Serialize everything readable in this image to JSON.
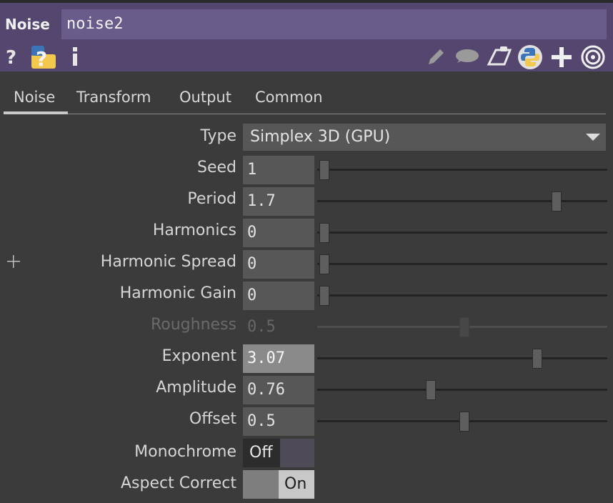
{
  "header": {
    "op_type": "Noise",
    "op_name": "noise2",
    "left_icons": [
      "help-icon",
      "operator-help-icon",
      "info-icon"
    ],
    "right_icons": [
      "pencil-icon",
      "comment-icon",
      "clipboard-icon",
      "python-icon",
      "plus-icon",
      "target-icon"
    ]
  },
  "tabs": [
    {
      "label": "Noise",
      "active": true
    },
    {
      "label": "Transform",
      "active": false
    },
    {
      "label": "Output",
      "active": false
    },
    {
      "label": "Common",
      "active": false
    }
  ],
  "params": {
    "type": {
      "label": "Type",
      "value": "Simplex 3D (GPU)"
    },
    "seed": {
      "label": "Seed",
      "value": "1",
      "slider": 0.0
    },
    "period": {
      "label": "Period",
      "value": "1.7",
      "slider": 0.83
    },
    "harmonics": {
      "label": "Harmonics",
      "value": "0",
      "slider": 0.0
    },
    "harmonic_spread": {
      "label": "Harmonic Spread",
      "value": "0",
      "slider": 0.0
    },
    "harmonic_gain": {
      "label": "Harmonic Gain",
      "value": "0",
      "slider": 0.0
    },
    "roughness": {
      "label": "Roughness",
      "value": "0.5",
      "slider": 0.5,
      "disabled": true
    },
    "exponent": {
      "label": "Exponent",
      "value": "3.07",
      "slider": 0.76
    },
    "amplitude": {
      "label": "Amplitude",
      "value": "0.76",
      "slider": 0.38
    },
    "offset": {
      "label": "Offset",
      "value": "0.5",
      "slider": 0.5
    },
    "monochrome": {
      "label": "Monochrome",
      "value": "Off"
    },
    "aspect_correct": {
      "label": "Aspect Correct",
      "value": "On"
    }
  },
  "colors": {
    "header_bg": "#54466e",
    "name_field_bg": "#6a5c8a",
    "panel_bg": "#3b3b3b",
    "python_yellow": "#f2c94c",
    "python_blue": "#3b74b8"
  }
}
